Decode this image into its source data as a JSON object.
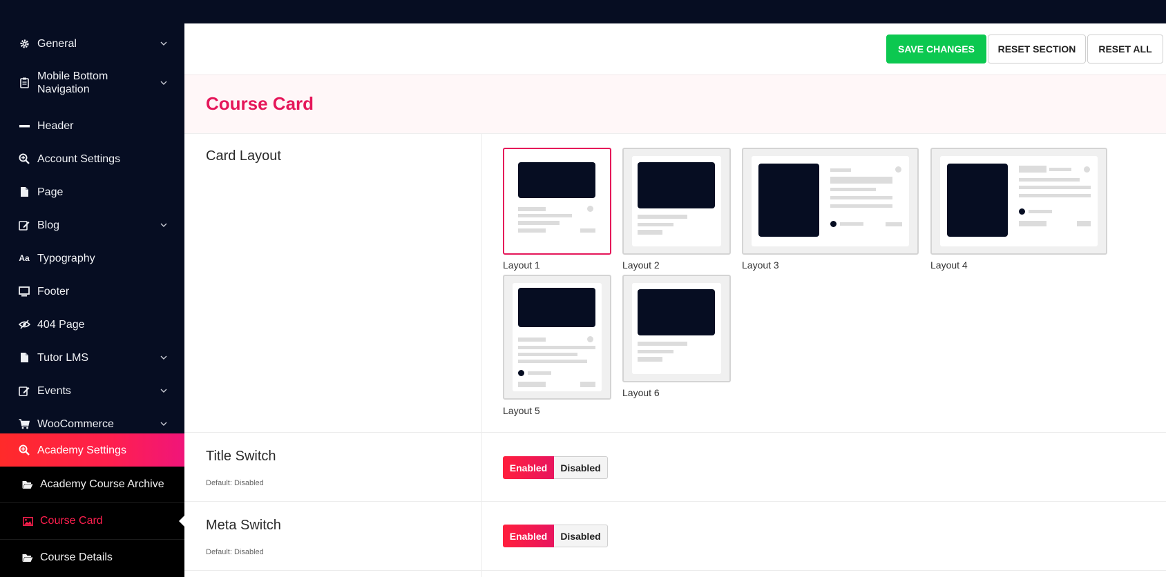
{
  "sidebar": {
    "items": [
      {
        "label": "General",
        "icon": "gear-icon",
        "has_children": true
      },
      {
        "label": "Mobile Bottom Navigation",
        "icon": "clipboard-icon",
        "has_children": true
      },
      {
        "label": "Header",
        "icon": "minus-icon",
        "has_children": false
      },
      {
        "label": "Account Settings",
        "icon": "search-plus-icon",
        "has_children": false
      },
      {
        "label": "Page",
        "icon": "document-icon",
        "has_children": false
      },
      {
        "label": "Blog",
        "icon": "edit-icon",
        "has_children": true
      },
      {
        "label": "Typography",
        "icon": "text-icon",
        "has_children": false
      },
      {
        "label": "Footer",
        "icon": "monitor-icon",
        "has_children": false
      },
      {
        "label": "404 Page",
        "icon": "eye-slash-icon",
        "has_children": false
      },
      {
        "label": "Tutor LMS",
        "icon": "document-icon",
        "has_children": true
      },
      {
        "label": "Events",
        "icon": "edit-icon",
        "has_children": true
      },
      {
        "label": "WooCommerce",
        "icon": "cart-icon",
        "has_children": true
      },
      {
        "label": "Academy Settings",
        "icon": "search-plus-icon",
        "has_children": false,
        "active": true
      }
    ],
    "sub_items": [
      {
        "label": "Academy Course Archive",
        "icon": "folder-open-icon"
      },
      {
        "label": "Course Card",
        "icon": "image-icon",
        "current": true
      },
      {
        "label": "Course Details",
        "icon": "folder-open-icon"
      }
    ]
  },
  "toolbar": {
    "save_label": "SAVE CHANGES",
    "reset_section_label": "RESET SECTION",
    "reset_all_label": "RESET ALL"
  },
  "section": {
    "title": "Course Card"
  },
  "card_layout": {
    "label": "Card Layout",
    "options": [
      {
        "caption": "Layout 1",
        "selected": true
      },
      {
        "caption": "Layout 2",
        "selected": false
      },
      {
        "caption": "Layout 3",
        "selected": false
      },
      {
        "caption": "Layout 4",
        "selected": false
      },
      {
        "caption": "Layout 5",
        "selected": false
      },
      {
        "caption": "Layout 6",
        "selected": false
      }
    ]
  },
  "title_switch": {
    "label": "Title Switch",
    "default_text": "Default: Disabled",
    "enabled_label": "Enabled",
    "disabled_label": "Disabled",
    "value": "Enabled"
  },
  "meta_switch": {
    "label": "Meta Switch",
    "default_text": "Default: Disabled",
    "enabled_label": "Enabled",
    "disabled_label": "Disabled",
    "value": "Enabled"
  },
  "colors": {
    "sidebar_bg": "#060d22",
    "accent": "#e5175a",
    "save_green": "#0cc850",
    "active_gradient_start": "#ff2a2a",
    "active_gradient_end": "#f0157a"
  }
}
